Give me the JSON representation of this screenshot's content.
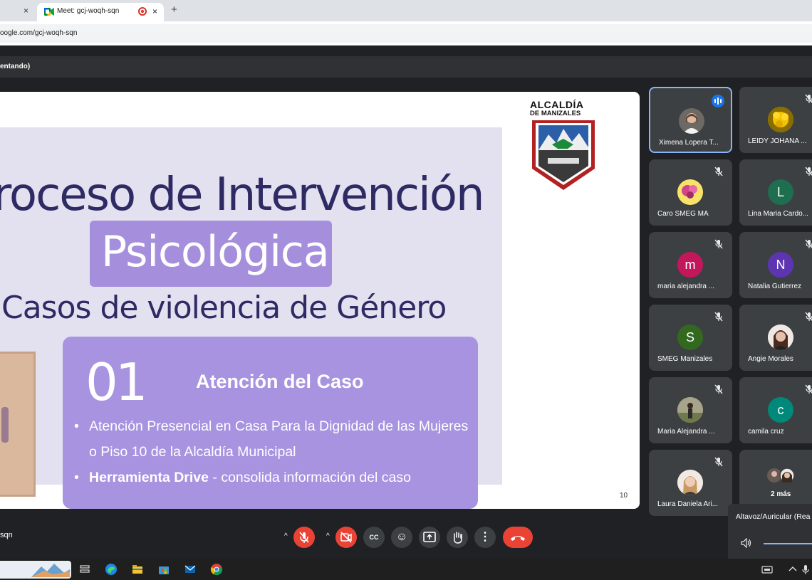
{
  "browser": {
    "tab_title": "Meet: gcj-woqh-sqn",
    "tab_close_glyph": "×",
    "new_tab_glyph": "+",
    "url": "oogle.com/gcj-woqh-sqn"
  },
  "meet": {
    "presenting_banner": "entando)",
    "meeting_code": "sqn"
  },
  "slide": {
    "title_line1": "roceso de Intervención",
    "title_line2": "Psicológica",
    "title_line3": "Casos de violencia de Género",
    "card_number": "01",
    "card_heading": "Atención del Caso",
    "bullet1": "Atención Presencial en Casa Para la Dignidad de las Mujeres o Piso 10 de la Alcaldía Municipal",
    "bullet2_bold": "Herramienta Drive",
    "bullet2_rest": " - consolida información del caso",
    "logo_title": "ALCALDÍA",
    "logo_subtitle": "DE MANIZALES",
    "page_number": "10"
  },
  "participants": [
    {
      "name": "Ximena Lopera T...",
      "avatar": "photo",
      "status": "speaking"
    },
    {
      "name": "LEIDY JOHANA ...",
      "avatar": "photo-yellow-flower",
      "status": "muted"
    },
    {
      "name": "Caro SMEG MA",
      "avatar": "photo-flower",
      "status": "muted"
    },
    {
      "name": "Lina Maria Cardo...",
      "avatar": "L",
      "color": "#1e6e4f",
      "status": "muted"
    },
    {
      "name": "maria alejandra ...",
      "avatar": "m",
      "color": "#c2185b",
      "status": "muted"
    },
    {
      "name": "Natalia Gutierrez",
      "avatar": "N",
      "color": "#5e35b1",
      "status": "muted"
    },
    {
      "name": "SMEG Manizales",
      "avatar": "S",
      "color": "#33691e",
      "status": "muted"
    },
    {
      "name": "Angie Morales",
      "avatar": "photo",
      "status": "muted"
    },
    {
      "name": "Maria Alejandra ...",
      "avatar": "photo",
      "status": "muted"
    },
    {
      "name": "camila cruz",
      "avatar": "c",
      "color": "#00897b",
      "status": "muted"
    },
    {
      "name": "Laura Daniela Ari...",
      "avatar": "photo",
      "status": "muted"
    },
    {
      "name": "2 más",
      "avatar": "group",
      "status": "none"
    }
  ],
  "audio_popup": {
    "label": "Altavoz/Auricular (Rea"
  },
  "controls": [
    {
      "name": "microphone-off",
      "glyph": "🎤"
    },
    {
      "name": "camera-off",
      "glyph": "📷"
    },
    {
      "name": "captions",
      "glyph": "CC"
    },
    {
      "name": "emoji-reaction",
      "glyph": "☺"
    },
    {
      "name": "present-now",
      "glyph": "⬆"
    },
    {
      "name": "raise-hand",
      "glyph": "✋"
    },
    {
      "name": "more-options",
      "glyph": "⋮"
    },
    {
      "name": "leave-call",
      "glyph": "✆"
    }
  ],
  "colors": {
    "meet_bg": "#202124",
    "tile_bg": "#3c4043",
    "accent_blue": "#1a73e8",
    "danger_red": "#ea4335",
    "slide_purple": "#a793e0",
    "slide_navy": "#2e2a63"
  }
}
